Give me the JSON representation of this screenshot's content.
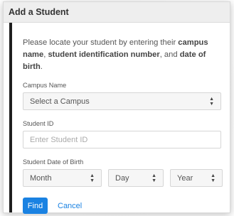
{
  "dialog": {
    "title": "Add a Student"
  },
  "intro": {
    "part1": "Please locate your student by entering their ",
    "campus_bold": "campus name",
    "part2": ", ",
    "id_bold": "student identification number",
    "part3": ", and ",
    "dob_bold": "date of birth",
    "part4": "."
  },
  "fields": {
    "campus": {
      "label": "Campus Name",
      "value": "Select a Campus"
    },
    "student_id": {
      "label": "Student ID",
      "placeholder": "Enter Student ID"
    },
    "dob": {
      "label": "Student Date of Birth",
      "month": "Month",
      "day": "Day",
      "year": "Year"
    }
  },
  "actions": {
    "find": "Find",
    "cancel": "Cancel"
  },
  "colors": {
    "primary": "#1a82e2",
    "header_bg": "#eeeeee",
    "left_bar": "#1f1f1f"
  },
  "icons": {
    "select_caret": "up-down-caret-icon"
  }
}
